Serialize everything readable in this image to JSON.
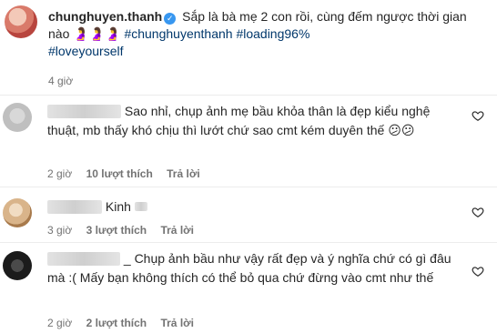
{
  "post": {
    "username": "chunghuyen.thanh",
    "caption": "Sắp là bà mẹ 2 con rồi, cùng đếm ngược thời gian nào",
    "caption_emoji": "🤰🤰🤰",
    "hashtags": [
      "#chunghuyenthanh",
      "#loading96%",
      "#loveyourself"
    ],
    "time": "4 giờ"
  },
  "comments": [
    {
      "text": "Sao nhỉ, chụp ảnh mẹ bầu khỏa thân là đẹp kiểu nghệ thuật, mb thấy khó chịu thì lướt chứ sao cmt kém duyên thế",
      "emoji": "😕😕",
      "time": "2 giờ",
      "likes": "10 lượt thích",
      "reply": "Trả lời"
    },
    {
      "text": "Kinh",
      "time": "3 giờ",
      "likes": "3 lượt thích",
      "reply": "Trả lời"
    },
    {
      "text": "_ Chụp ảnh bầu như vậy rất đẹp và ý nghĩa chứ có gì đâu mà :( Mấy bạn không thích có thể bỏ qua chứ đừng vào cmt như thế",
      "time": "2 giờ",
      "likes": "2 lượt thích",
      "reply": "Trả lời"
    }
  ],
  "colors": {
    "verified": "#3897f0",
    "hashtag": "#00376b",
    "meta": "#737373"
  }
}
